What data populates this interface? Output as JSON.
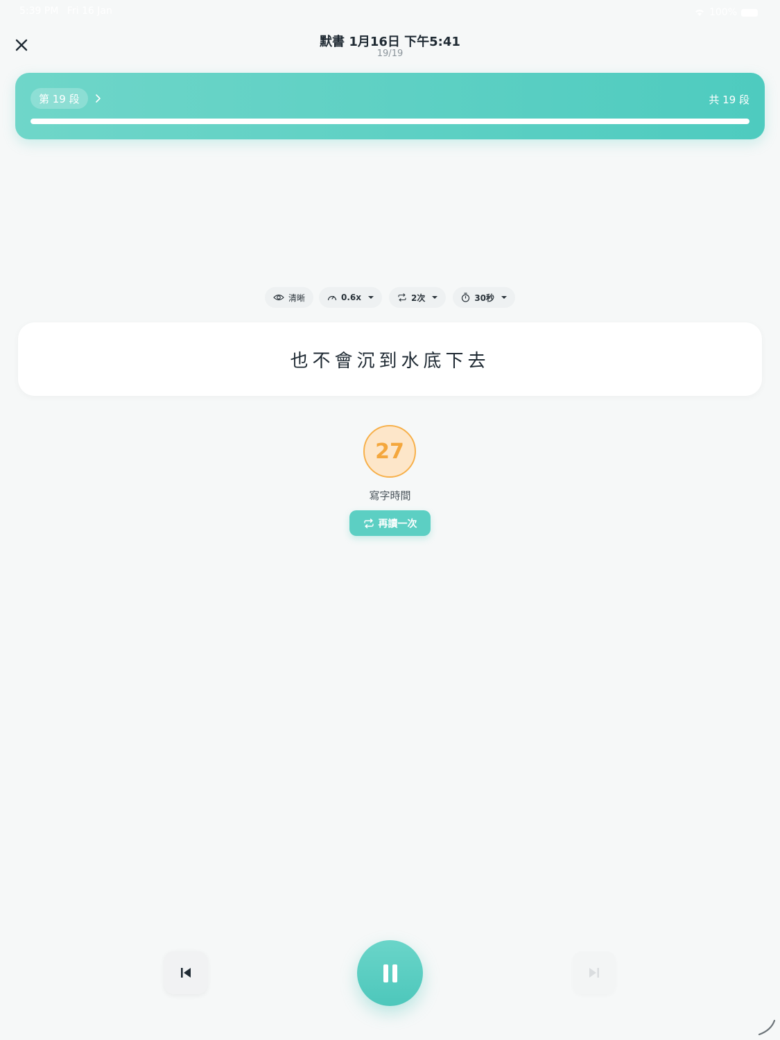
{
  "status_bar": {
    "time": "5:39 PM",
    "date": "Fri 16 Jan",
    "battery": "100%"
  },
  "header": {
    "title": "默書 1月16日 下午5:41",
    "subtitle": "19/19"
  },
  "progress": {
    "current_label": "第 19 段",
    "total_label": "共 19 段",
    "fraction": 1.0
  },
  "settings": {
    "clarity": "清晰",
    "speed": "0.6x",
    "repeat": "2次",
    "time_limit": "30秒"
  },
  "sentence": "也不會沉到水底下去",
  "timer": {
    "value": "27",
    "label": "寫字時間"
  },
  "reread_button": "再讀一次",
  "colors": {
    "accent": "#5ccfc3",
    "timer_ring": "#f7b04a",
    "timer_fill": "#fde6c9",
    "background": "#f6f8f8"
  },
  "icons": {
    "close": "close-icon",
    "clarity": "eye-icon",
    "speed": "gauge-icon",
    "repeat": "repeat-icon",
    "time_limit": "stopwatch-icon",
    "reread": "repeat-icon",
    "prev": "skip-previous-icon",
    "play_pause": "pause-icon",
    "next": "skip-next-icon"
  }
}
